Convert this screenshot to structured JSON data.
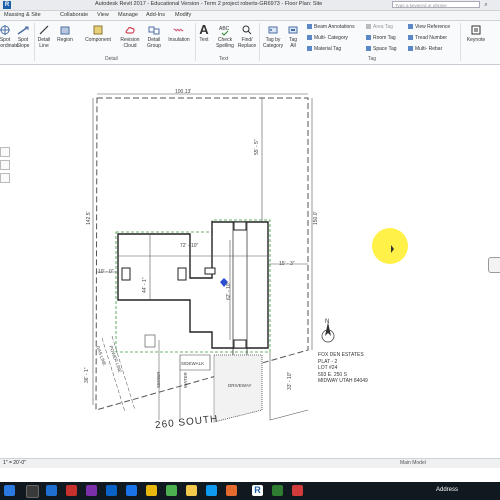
{
  "window": {
    "title": "Autodesk Revit 2017 - Educational Version -    Term 2 project roberts-GR6973 - Floor Plan: Site",
    "search_placeholder": "Type a keyword or phrase"
  },
  "tabs": [
    "Massing & Site",
    "Collaborate",
    "View",
    "Manage",
    "Add-Ins",
    "Modify"
  ],
  "ribbon": {
    "buttons": [
      {
        "label": "Spot\nCoordinate",
        "icon": "spot-coordinate-icon"
      },
      {
        "label": "Spot\nSlope",
        "icon": "spot-slope-icon"
      },
      {
        "label": "Detail\nLine",
        "icon": "detail-line-icon"
      },
      {
        "label": "Region",
        "icon": "region-icon"
      },
      {
        "label": "Component",
        "icon": "component-icon"
      },
      {
        "label": "Revision\nCloud",
        "icon": "revision-cloud-icon"
      },
      {
        "label": "Detail\nGroup",
        "icon": "detail-group-icon"
      },
      {
        "label": "Insulation",
        "icon": "insulation-icon"
      },
      {
        "label": "Text",
        "icon": "text-icon"
      },
      {
        "label": "Check\nSpelling",
        "icon": "check-spelling-icon"
      },
      {
        "label": "Find/\nReplace",
        "icon": "find-replace-icon"
      },
      {
        "label": "Tag by\nCategory",
        "icon": "tag-by-category-icon"
      },
      {
        "label": "Tag\nAll",
        "icon": "tag-all-icon"
      },
      {
        "label": "Keynote",
        "icon": "keynote-icon"
      }
    ],
    "small": [
      "Beam Annotations",
      "Multi- Category",
      "Material Tag",
      "Area Tag",
      "Room Tag",
      "Space Tag",
      "View Reference",
      "Tread Number",
      "Multi- Rebar"
    ],
    "panels": [
      "Detail",
      "Text",
      "Tag"
    ]
  },
  "drawing": {
    "street": "260 SOUTH",
    "dims": [
      "100.13'",
      "55' - 5\"",
      "142.5'",
      "150.0'",
      "72' - 10\"",
      "10' - 0\"",
      "44' - 1\"",
      "62' - 10\"",
      "15' - 3\"",
      "36' - 1\"",
      "33' - 10\""
    ],
    "labels": {
      "gas_line": "GAS LINE",
      "power_line": "POWER LINE",
      "sidewalk": "SIDEWALK",
      "driveway": "DRIVEWAY",
      "sewer": "SEWER",
      "water": "WATER"
    },
    "address": [
      "FOX DEN ESTATES",
      "PLAT - 2",
      "LOT #24",
      "593 E. 250 S",
      "MIDWAY UTAH 84049"
    ]
  },
  "status": {
    "scale": "1\" = 20'-0\"",
    "model": "Main Model",
    "taskbar_address": "Address"
  },
  "colors": {
    "property_line": "#555555",
    "setback": "#3a9a3a",
    "building": "#222222",
    "highlight": "#ffee28"
  }
}
